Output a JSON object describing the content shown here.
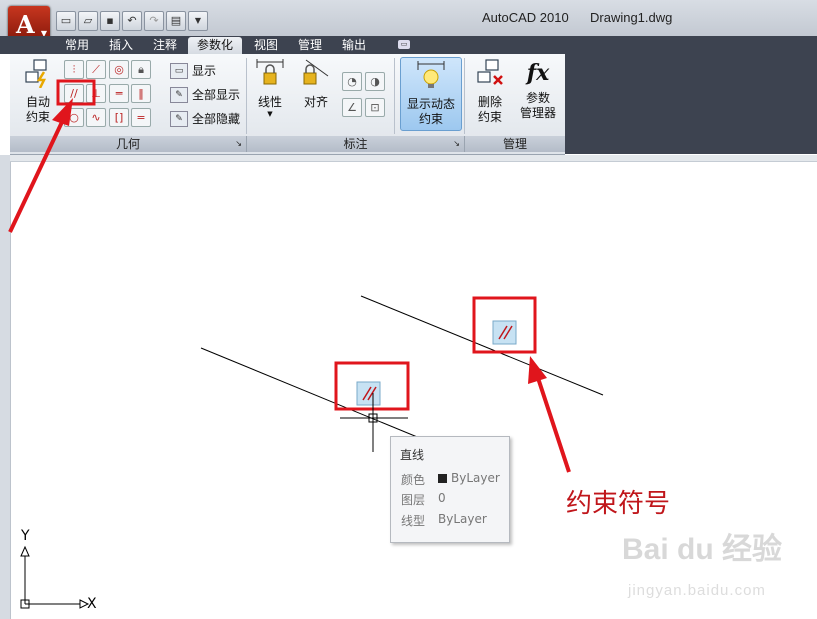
{
  "title_bar": {
    "app_name": "AutoCAD 2010",
    "file_name": "Drawing1.dwg"
  },
  "tabs": [
    "常用",
    "插入",
    "注释",
    "参数化",
    "视图",
    "管理",
    "输出"
  ],
  "active_tab": "参数化",
  "ribbon": {
    "geometry_panel": {
      "title": "几何",
      "auto_constrain": "自动\n约束",
      "display_buttons": [
        "显示",
        "全部显示",
        "全部隐藏"
      ]
    },
    "dimension_panel": {
      "title": "标注",
      "linear": "线性",
      "aligned": "对齐"
    },
    "manage_panel": {
      "title": "管理",
      "show_dynamic": "显示动态\n约束",
      "delete_constraints": "删除\n约束",
      "param_manager": "参数\n管理器"
    },
    "fx_symbol": "fx"
  },
  "tooltip": {
    "title": "直线",
    "rows": [
      {
        "label": "颜色",
        "value": "ByLayer"
      },
      {
        "label": "图层",
        "value": "0"
      },
      {
        "label": "线型",
        "value": "ByLayer"
      }
    ]
  },
  "annotation_text": "约束符号",
  "ucs": {
    "x_label": "X",
    "y_label": "Y"
  },
  "watermark": {
    "brand": "Bai du 经验",
    "url": "jingyan.baidu.com"
  },
  "colors": {
    "annotation_red": "#e0151c",
    "ribbon_dark": "#3d4350",
    "active_button": "#9dc8ef"
  }
}
